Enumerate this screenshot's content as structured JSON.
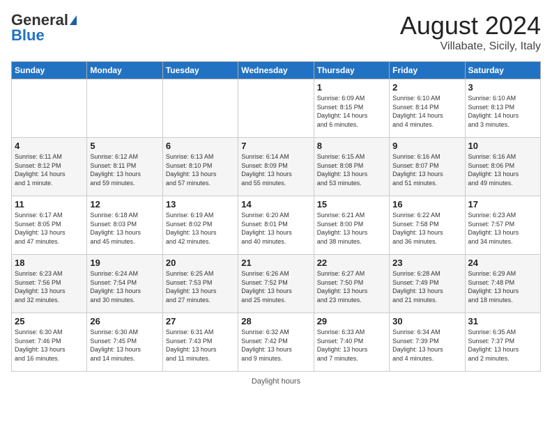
{
  "header": {
    "logo_line1": "General",
    "logo_line2": "Blue",
    "month_year": "August 2024",
    "location": "Villabate, Sicily, Italy"
  },
  "days_of_week": [
    "Sunday",
    "Monday",
    "Tuesday",
    "Wednesday",
    "Thursday",
    "Friday",
    "Saturday"
  ],
  "footer_text": "Daylight hours",
  "weeks": [
    [
      {
        "num": "",
        "info": ""
      },
      {
        "num": "",
        "info": ""
      },
      {
        "num": "",
        "info": ""
      },
      {
        "num": "",
        "info": ""
      },
      {
        "num": "1",
        "info": "Sunrise: 6:09 AM\nSunset: 8:15 PM\nDaylight: 14 hours\nand 6 minutes."
      },
      {
        "num": "2",
        "info": "Sunrise: 6:10 AM\nSunset: 8:14 PM\nDaylight: 14 hours\nand 4 minutes."
      },
      {
        "num": "3",
        "info": "Sunrise: 6:10 AM\nSunset: 8:13 PM\nDaylight: 14 hours\nand 3 minutes."
      }
    ],
    [
      {
        "num": "4",
        "info": "Sunrise: 6:11 AM\nSunset: 8:12 PM\nDaylight: 14 hours\nand 1 minute."
      },
      {
        "num": "5",
        "info": "Sunrise: 6:12 AM\nSunset: 8:11 PM\nDaylight: 13 hours\nand 59 minutes."
      },
      {
        "num": "6",
        "info": "Sunrise: 6:13 AM\nSunset: 8:10 PM\nDaylight: 13 hours\nand 57 minutes."
      },
      {
        "num": "7",
        "info": "Sunrise: 6:14 AM\nSunset: 8:09 PM\nDaylight: 13 hours\nand 55 minutes."
      },
      {
        "num": "8",
        "info": "Sunrise: 6:15 AM\nSunset: 8:08 PM\nDaylight: 13 hours\nand 53 minutes."
      },
      {
        "num": "9",
        "info": "Sunrise: 6:16 AM\nSunset: 8:07 PM\nDaylight: 13 hours\nand 51 minutes."
      },
      {
        "num": "10",
        "info": "Sunrise: 6:16 AM\nSunset: 8:06 PM\nDaylight: 13 hours\nand 49 minutes."
      }
    ],
    [
      {
        "num": "11",
        "info": "Sunrise: 6:17 AM\nSunset: 8:05 PM\nDaylight: 13 hours\nand 47 minutes."
      },
      {
        "num": "12",
        "info": "Sunrise: 6:18 AM\nSunset: 8:03 PM\nDaylight: 13 hours\nand 45 minutes."
      },
      {
        "num": "13",
        "info": "Sunrise: 6:19 AM\nSunset: 8:02 PM\nDaylight: 13 hours\nand 42 minutes."
      },
      {
        "num": "14",
        "info": "Sunrise: 6:20 AM\nSunset: 8:01 PM\nDaylight: 13 hours\nand 40 minutes."
      },
      {
        "num": "15",
        "info": "Sunrise: 6:21 AM\nSunset: 8:00 PM\nDaylight: 13 hours\nand 38 minutes."
      },
      {
        "num": "16",
        "info": "Sunrise: 6:22 AM\nSunset: 7:58 PM\nDaylight: 13 hours\nand 36 minutes."
      },
      {
        "num": "17",
        "info": "Sunrise: 6:23 AM\nSunset: 7:57 PM\nDaylight: 13 hours\nand 34 minutes."
      }
    ],
    [
      {
        "num": "18",
        "info": "Sunrise: 6:23 AM\nSunset: 7:56 PM\nDaylight: 13 hours\nand 32 minutes."
      },
      {
        "num": "19",
        "info": "Sunrise: 6:24 AM\nSunset: 7:54 PM\nDaylight: 13 hours\nand 30 minutes."
      },
      {
        "num": "20",
        "info": "Sunrise: 6:25 AM\nSunset: 7:53 PM\nDaylight: 13 hours\nand 27 minutes."
      },
      {
        "num": "21",
        "info": "Sunrise: 6:26 AM\nSunset: 7:52 PM\nDaylight: 13 hours\nand 25 minutes."
      },
      {
        "num": "22",
        "info": "Sunrise: 6:27 AM\nSunset: 7:50 PM\nDaylight: 13 hours\nand 23 minutes."
      },
      {
        "num": "23",
        "info": "Sunrise: 6:28 AM\nSunset: 7:49 PM\nDaylight: 13 hours\nand 21 minutes."
      },
      {
        "num": "24",
        "info": "Sunrise: 6:29 AM\nSunset: 7:48 PM\nDaylight: 13 hours\nand 18 minutes."
      }
    ],
    [
      {
        "num": "25",
        "info": "Sunrise: 6:30 AM\nSunset: 7:46 PM\nDaylight: 13 hours\nand 16 minutes."
      },
      {
        "num": "26",
        "info": "Sunrise: 6:30 AM\nSunset: 7:45 PM\nDaylight: 13 hours\nand 14 minutes."
      },
      {
        "num": "27",
        "info": "Sunrise: 6:31 AM\nSunset: 7:43 PM\nDaylight: 13 hours\nand 11 minutes."
      },
      {
        "num": "28",
        "info": "Sunrise: 6:32 AM\nSunset: 7:42 PM\nDaylight: 13 hours\nand 9 minutes."
      },
      {
        "num": "29",
        "info": "Sunrise: 6:33 AM\nSunset: 7:40 PM\nDaylight: 13 hours\nand 7 minutes."
      },
      {
        "num": "30",
        "info": "Sunrise: 6:34 AM\nSunset: 7:39 PM\nDaylight: 13 hours\nand 4 minutes."
      },
      {
        "num": "31",
        "info": "Sunrise: 6:35 AM\nSunset: 7:37 PM\nDaylight: 13 hours\nand 2 minutes."
      }
    ]
  ]
}
